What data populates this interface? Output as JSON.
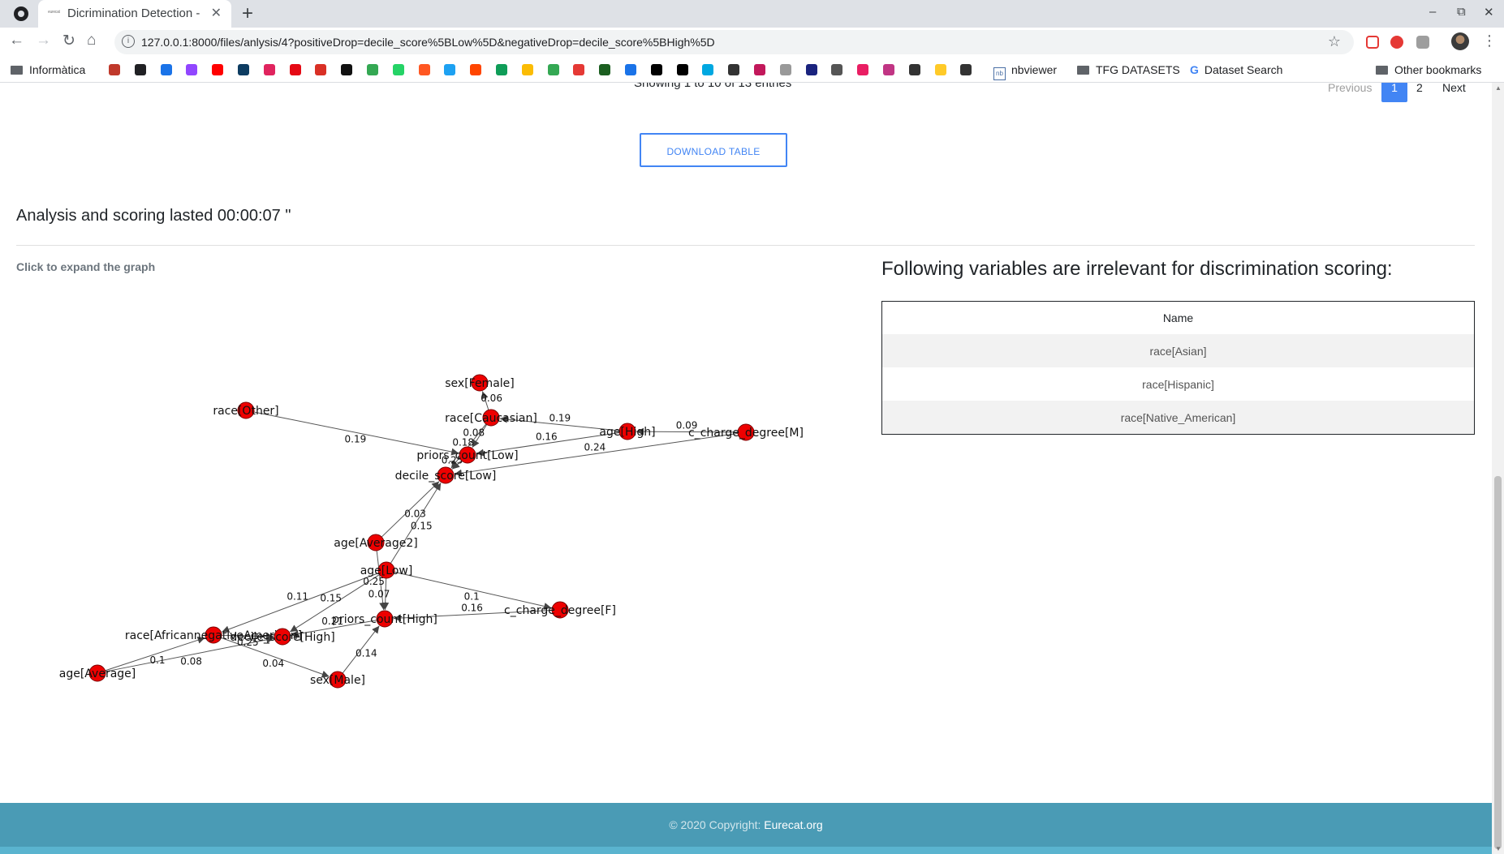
{
  "browser": {
    "tab_title": "Dicrimination Detection -",
    "tab_favicon_text": "eurecat",
    "tab_close": "✕",
    "new_tab": "+",
    "url": "127.0.0.1:8000/files/anlysis/4?positiveDrop=decile_score%5BLow%5D&negativeDrop=decile_score%5BHigh%5D",
    "window_controls": [
      "–",
      "⧉",
      "✕"
    ]
  },
  "bookmarks": {
    "informatica": "Informàtica",
    "nbviewer": "nbviewer",
    "tfg": "TFG DATASETS",
    "dataset_search": "Dataset Search",
    "other": "Other bookmarks",
    "icon_colors": [
      "#c0392b",
      "#202124",
      "#1a73e8",
      "#9146ff",
      "#ff0000",
      "#0d3c61",
      "#e0245e",
      "#e50914",
      "#d93025",
      "#111111",
      "#34a853",
      "#25d366",
      "#ff5722",
      "#1da1f2",
      "#ff4500",
      "#0f9d58",
      "#fbbc04",
      "#34a853",
      "#e53935",
      "#1b5e20",
      "#1a73e8",
      "#000000",
      "#000000",
      "#00a8e1",
      "#333333",
      "#c2185b",
      "#999999",
      "#1a237e",
      "#555555",
      "#e91e63",
      "#c13584",
      "#333333",
      "#ffca28",
      "#333333"
    ]
  },
  "pagination": {
    "info": "Showing 1 to 10 of 13 entries",
    "previous": "Previous",
    "active": "1",
    "page2": "2",
    "next": "Next"
  },
  "download_button": "DOWNLOAD TABLE",
  "analysis_text": "Analysis and scoring lasted 00:00:07 \"",
  "expand_link": "Click to expand the graph",
  "irrelevant": {
    "title": "Following variables are irrelevant for discrimination scoring:",
    "header": "Name",
    "rows": [
      "race[Asian]",
      "race[Hispanic]",
      "race[Native_American]"
    ]
  },
  "graph": {
    "nodes": [
      {
        "id": "sex_female",
        "label": "sex[Female]"
      },
      {
        "id": "race_other",
        "label": "race[Other]"
      },
      {
        "id": "race_caucasian",
        "label": "race[Caucasian]"
      },
      {
        "id": "age_high",
        "label": "age[High]"
      },
      {
        "id": "c_charge_m",
        "label": "c_charge_degree[M]"
      },
      {
        "id": "priors_low",
        "label": "priors_count[Low]"
      },
      {
        "id": "decile_low",
        "label": "decile_score[Low]"
      },
      {
        "id": "age_average2",
        "label": "age[Average2]"
      },
      {
        "id": "age_low",
        "label": "age[Low]"
      },
      {
        "id": "c_charge_f",
        "label": "c_charge_degree[F]"
      },
      {
        "id": "priors_high",
        "label": "priors_count[High]"
      },
      {
        "id": "race_african",
        "label": "race[AfricannegativeAmerican]"
      },
      {
        "id": "decile_high",
        "label": "decile_score[High]"
      },
      {
        "id": "age_average",
        "label": "age[Average]"
      },
      {
        "id": "sex_male",
        "label": "sex[Male]"
      }
    ],
    "edges": [
      {
        "from": "race_other",
        "to": "priors_low",
        "weight": "0.19"
      },
      {
        "from": "race_caucasian",
        "to": "sex_female",
        "weight": "0.06"
      },
      {
        "from": "race_caucasian",
        "to": "priors_low",
        "weight": "0.08"
      },
      {
        "from": "race_caucasian",
        "to": "decile_low",
        "weight": "0.18"
      },
      {
        "from": "age_high",
        "to": "race_caucasian",
        "weight": "0.19"
      },
      {
        "from": "age_high",
        "to": "priors_low",
        "weight": "0.16"
      },
      {
        "from": "c_charge_m",
        "to": "age_high",
        "weight": "0.09"
      },
      {
        "from": "c_charge_m",
        "to": "decile_low",
        "weight": "0.24"
      },
      {
        "from": "priors_low",
        "to": "decile_low",
        "weight": "0.25"
      },
      {
        "from": "age_average2",
        "to": "decile_low",
        "weight": "0.03"
      },
      {
        "from": "age_low",
        "to": "decile_low",
        "weight": "0.15"
      },
      {
        "from": "age_low",
        "to": "priors_high",
        "weight": "0.07"
      },
      {
        "from": "age_low",
        "to": "c_charge_f",
        "weight": "0.1"
      },
      {
        "from": "age_low",
        "to": "race_african",
        "weight": "0.11"
      },
      {
        "from": "age_low",
        "to": "decile_high",
        "weight": "0.15"
      },
      {
        "from": "priors_high",
        "to": "decile_high",
        "weight": "0.21"
      },
      {
        "from": "c_charge_f",
        "to": "priors_high",
        "weight": "0.16"
      },
      {
        "from": "race_african",
        "to": "decile_high",
        "weight": "0.25"
      },
      {
        "from": "sex_male",
        "to": "priors_high",
        "weight": "0.14"
      },
      {
        "from": "age_average",
        "to": "race_african",
        "weight": "0.1"
      },
      {
        "from": "age_average",
        "to": "decile_high",
        "weight": "0.08"
      },
      {
        "from": "race_african",
        "to": "sex_male",
        "weight": "0.04"
      },
      {
        "from": "age_average2",
        "to": "priors_high",
        "weight": "0.25"
      }
    ],
    "node_color": "#ee0000"
  },
  "footer": {
    "copyright": "© 2020 Copyright:",
    "link": "Eurecat.org"
  }
}
